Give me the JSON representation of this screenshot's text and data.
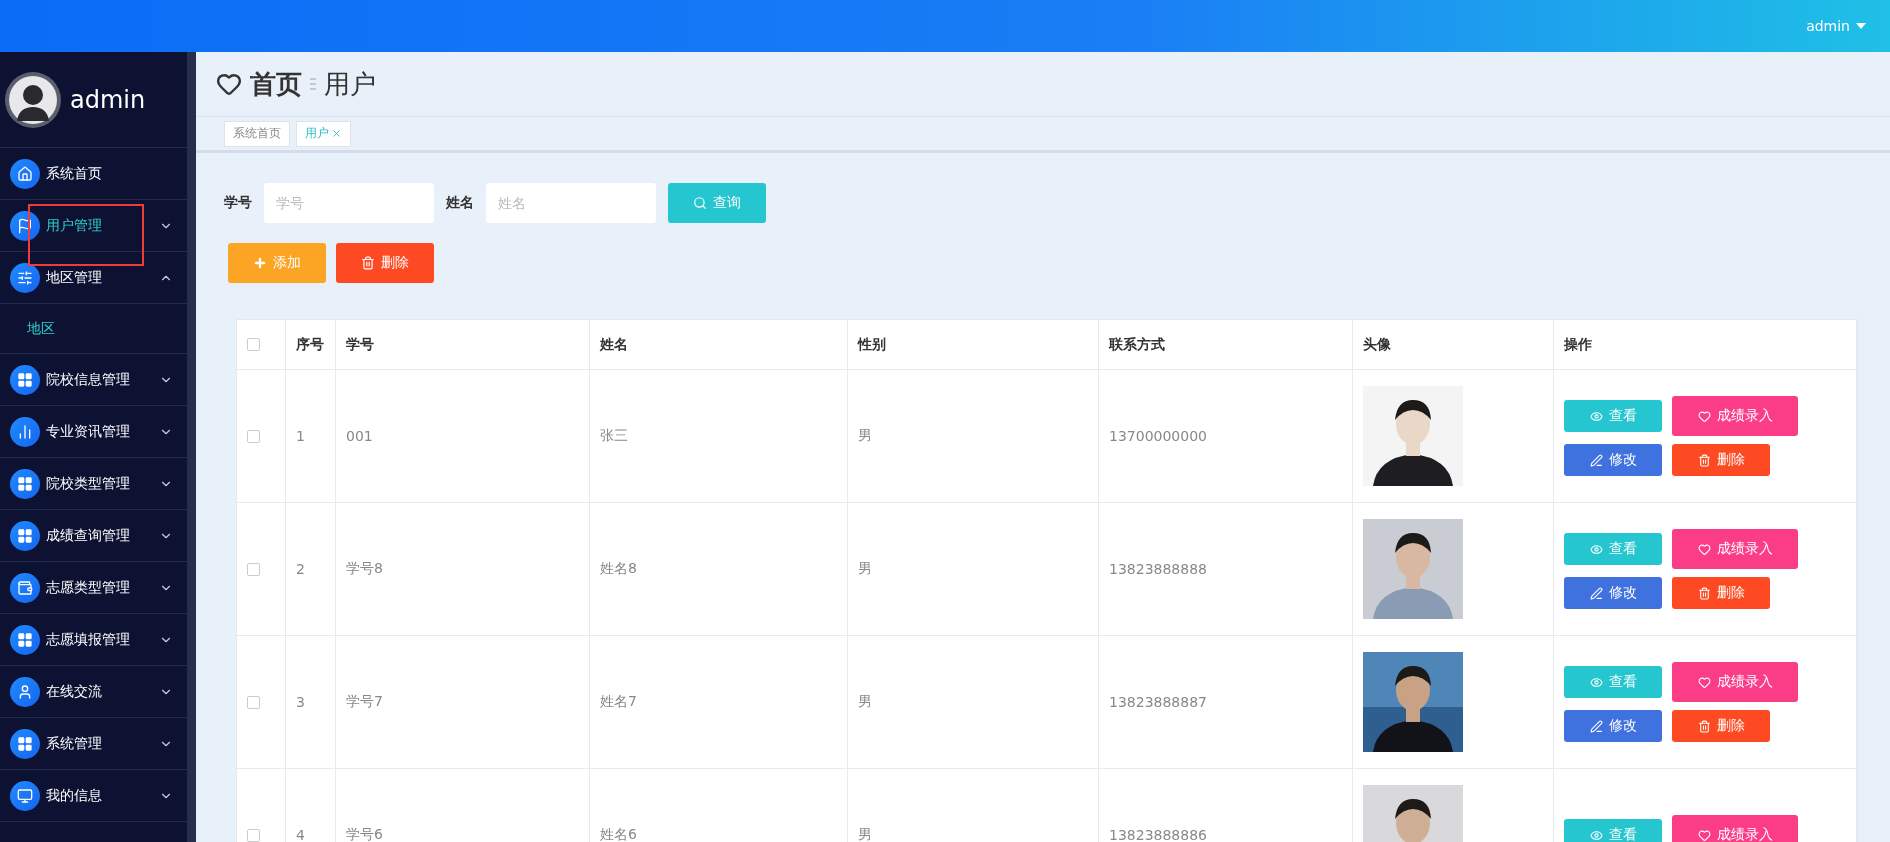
{
  "topbar": {
    "user": "admin"
  },
  "sidebar": {
    "user": "admin",
    "items": [
      {
        "label": "系统首页",
        "kind": "link",
        "active": false
      },
      {
        "label": "用户管理",
        "kind": "group",
        "expanded": false,
        "active": true
      },
      {
        "label": "地区管理",
        "kind": "group",
        "expanded": true,
        "active": false,
        "children": [
          {
            "label": "地区",
            "active": true
          }
        ]
      },
      {
        "label": "院校信息管理",
        "kind": "group",
        "expanded": false,
        "active": false
      },
      {
        "label": "专业资讯管理",
        "kind": "group",
        "expanded": false,
        "active": false
      },
      {
        "label": "院校类型管理",
        "kind": "group",
        "expanded": false,
        "active": false
      },
      {
        "label": "成绩查询管理",
        "kind": "group",
        "expanded": false,
        "active": false
      },
      {
        "label": "志愿类型管理",
        "kind": "group",
        "expanded": false,
        "active": false
      },
      {
        "label": "志愿填报管理",
        "kind": "group",
        "expanded": false,
        "active": false
      },
      {
        "label": "在线交流",
        "kind": "group",
        "expanded": false,
        "active": false
      },
      {
        "label": "系统管理",
        "kind": "group",
        "expanded": false,
        "active": false
      },
      {
        "label": "我的信息",
        "kind": "group",
        "expanded": false,
        "active": false
      }
    ]
  },
  "header": {
    "title": "首页",
    "subtitle": "用户"
  },
  "tabs": [
    {
      "label": "系统首页",
      "selected": false,
      "closable": false
    },
    {
      "label": "用户",
      "selected": true,
      "closable": true
    }
  ],
  "search": {
    "fields": [
      {
        "label": "学号",
        "placeholder": "学号"
      },
      {
        "label": "姓名",
        "placeholder": "姓名"
      }
    ],
    "button": "查询"
  },
  "toolbar": [
    {
      "label": "添加",
      "kind": "add"
    },
    {
      "label": "删除",
      "kind": "delete"
    }
  ],
  "table": {
    "header_checked": false,
    "columns": [
      "序号",
      "学号",
      "姓名",
      "性别",
      "联系方式",
      "头像",
      "操作"
    ],
    "rows": [
      {
        "checked": false,
        "cells": [
          "1",
          "001",
          "张三",
          "男",
          "13700000000"
        ],
        "photo": {
          "kind": "picture"
        },
        "actions": [
          {
            "label": "查看",
            "kind": "view"
          },
          {
            "label": "成绩录入",
            "kind": "score"
          },
          {
            "label": "修改",
            "kind": "edit"
          },
          {
            "label": "删除",
            "kind": "delete"
          }
        ]
      },
      {
        "checked": false,
        "cells": [
          "2",
          "学号8",
          "姓名8",
          "男",
          "13823888888"
        ],
        "photo": {
          "kind": "picture"
        },
        "actions": [
          {
            "label": "查看",
            "kind": "view"
          },
          {
            "label": "成绩录入",
            "kind": "score"
          },
          {
            "label": "修改",
            "kind": "edit"
          },
          {
            "label": "删除",
            "kind": "delete"
          }
        ]
      },
      {
        "checked": false,
        "cells": [
          "3",
          "学号7",
          "姓名7",
          "男",
          "13823888887"
        ],
        "photo": {
          "kind": "picture"
        },
        "actions": [
          {
            "label": "查看",
            "kind": "view"
          },
          {
            "label": "成绩录入",
            "kind": "score"
          },
          {
            "label": "修改",
            "kind": "edit"
          },
          {
            "label": "删除",
            "kind": "delete"
          }
        ]
      },
      {
        "checked": false,
        "cells": [
          "4",
          "学号6",
          "姓名6",
          "男",
          "13823888886"
        ],
        "photo": {
          "kind": "picture"
        },
        "actions": [
          {
            "label": "查看",
            "kind": "view"
          },
          {
            "label": "成绩录入",
            "kind": "score"
          }
        ]
      }
    ]
  }
}
